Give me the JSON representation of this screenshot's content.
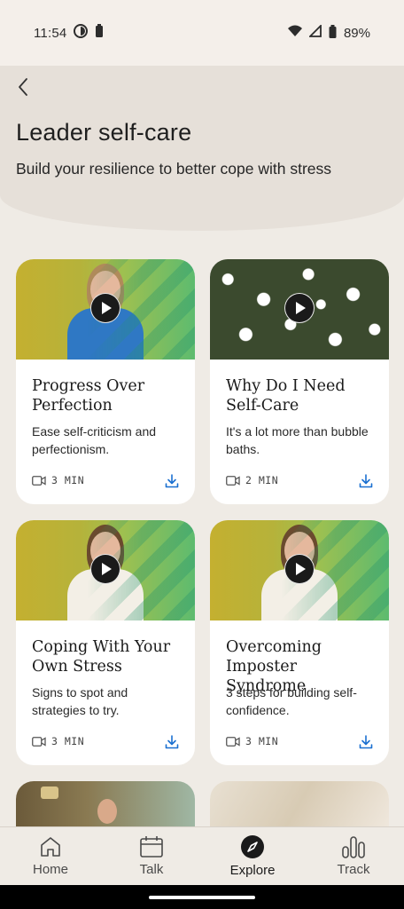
{
  "status_bar": {
    "time": "11:54",
    "battery": "89%"
  },
  "header": {
    "title": "Leader self-care",
    "subtitle": "Build your resilience to better cope with stress"
  },
  "cards": [
    {
      "title": "Progress Over Perfection",
      "description": "Ease self-criticism and perfectionism.",
      "duration": "3 MIN"
    },
    {
      "title": "Why Do I Need Self-Care",
      "description": "It's a lot more than bubble baths.",
      "duration": "2 MIN"
    },
    {
      "title": "Coping With Your Own Stress",
      "description": "Signs to spot and strategies to try.",
      "duration": "3 MIN"
    },
    {
      "title": "Overcoming Imposter Syndrome",
      "description": "3 steps for building self-confidence.",
      "duration": "3 MIN"
    }
  ],
  "nav": {
    "items": [
      {
        "label": "Home",
        "icon": "home-icon"
      },
      {
        "label": "Talk",
        "icon": "calendar-icon"
      },
      {
        "label": "Explore",
        "icon": "compass-icon",
        "active": true
      },
      {
        "label": "Track",
        "icon": "bar-chart-icon"
      }
    ]
  },
  "colors": {
    "accent": "#1a6fd0",
    "background": "#efebe5",
    "card": "#ffffff"
  }
}
